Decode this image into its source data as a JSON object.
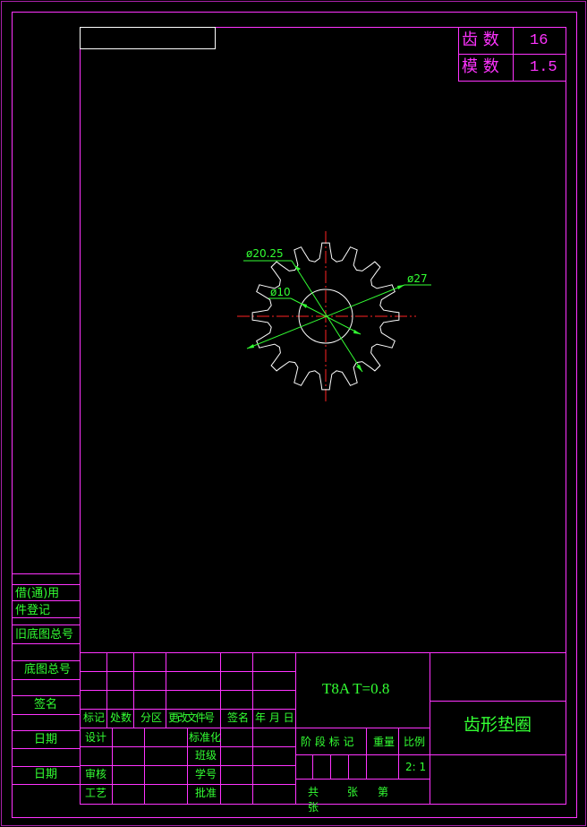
{
  "params_table": {
    "row1": {
      "label": "齿  数",
      "value": "16"
    },
    "row2": {
      "label": "模  数",
      "value": "1.5"
    }
  },
  "dimensions": {
    "root_diameter": "ø20.25",
    "bore_diameter": "ø10",
    "outer_diameter": "ø27"
  },
  "side_block": {
    "borrow_register_line1": "借(通)用",
    "borrow_register_line2": "件登记",
    "old_base_drawing_no": "旧底图总号",
    "base_drawing_no": "底图总号",
    "signature": "签名",
    "date1": "日期",
    "date2": "日期"
  },
  "title_block": {
    "material_thickness": "T8A   T=0.8",
    "part_name": "齿形垫圈",
    "revision_header": [
      "标记",
      "处数",
      "分区",
      "更改文件号",
      "签名",
      "年 月 日"
    ],
    "design": "设计",
    "standardization": "标准化",
    "class": "班级",
    "review": "审核",
    "student_id": "学号",
    "process": "工艺",
    "approve": "批准",
    "stage_mark": "阶 段 标 记",
    "weight": "重量",
    "scale_label": "比例",
    "scale_value": "2: 1",
    "sheets_total": "共",
    "sheets_zhang": "张",
    "sheets_di": "第",
    "sheets_zhang2": "张"
  },
  "colors": {
    "frame": "#ff33ff",
    "text": "#33ff33",
    "gear": "#ffffff",
    "centerline": "#ff2222",
    "background": "#000000"
  },
  "gear": {
    "teeth": 16,
    "module": 1.5
  }
}
